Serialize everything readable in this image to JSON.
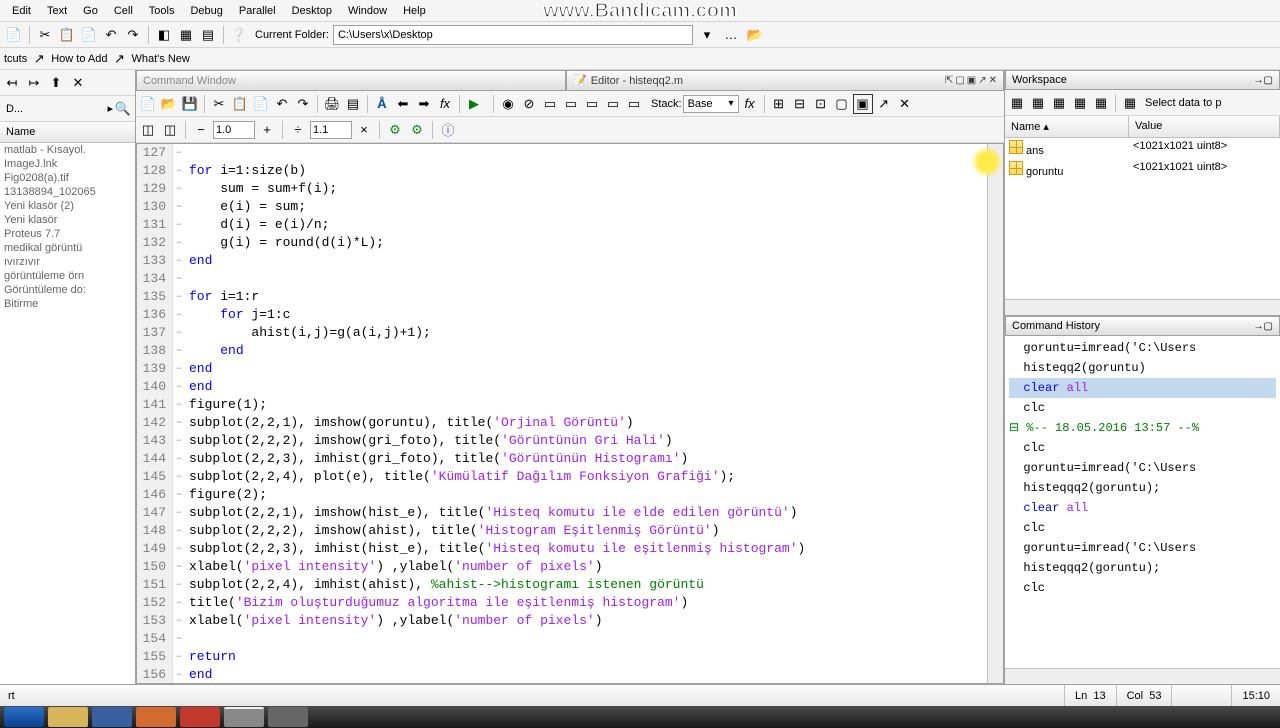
{
  "watermark": "www.Bandicam.com",
  "menus": [
    "Edit",
    "Text",
    "Go",
    "Cell",
    "Tools",
    "Debug",
    "Parallel",
    "Desktop",
    "Window",
    "Help"
  ],
  "toolbar1": {
    "current_folder_label": "Current Folder:",
    "current_folder_value": "C:\\Users\\x\\Desktop"
  },
  "shortcuts": {
    "cuts": "tcuts",
    "how_to_add": "How to Add",
    "whats_new": "What's New"
  },
  "left": {
    "addr_fragment": "D...",
    "name_col": "Name",
    "files": [
      "matlab - Kısayol.",
      "ImageJ.lnk",
      "Fig0208(a).tif",
      "13138894_102065",
      "Yeni klasör (2)",
      "Yeni klasör",
      "Proteus 7.7",
      "medikal görüntü",
      "ıvırzıvır",
      "görüntüleme örn",
      "Görüntüleme do:",
      "Bitirme"
    ]
  },
  "center": {
    "cmd_title": "Command Window",
    "editor_title": "Editor - histeqq2.m",
    "stack_label": "Stack:",
    "stack_value": "Base",
    "zoom1": "1.0",
    "zoom2": "1.1",
    "lines": [
      {
        "n": 127,
        "html": ""
      },
      {
        "n": 128,
        "html": "<span class='kw'>for</span> i=1:size(b)"
      },
      {
        "n": 129,
        "html": "    sum = sum+f(i);"
      },
      {
        "n": 130,
        "html": "    e(i) = sum;"
      },
      {
        "n": 131,
        "html": "    d(i) = e(i)/n;"
      },
      {
        "n": 132,
        "html": "    g(i) = round(d(i)*L);"
      },
      {
        "n": 133,
        "html": "<span class='kw'>end</span>"
      },
      {
        "n": 134,
        "html": ""
      },
      {
        "n": 135,
        "html": "<span class='kw'>for</span> i=1:r"
      },
      {
        "n": 136,
        "html": "    <span class='kw'>for</span> j=1:c"
      },
      {
        "n": 137,
        "html": "        ahist(i,j)=g(a(i,j)+1);"
      },
      {
        "n": 138,
        "html": "    <span class='kw'>end</span>"
      },
      {
        "n": 139,
        "html": "<span class='kw'>end</span>"
      },
      {
        "n": 140,
        "html": "<span class='kw'>end</span>"
      },
      {
        "n": 141,
        "html": "figure(1);"
      },
      {
        "n": 142,
        "html": "subplot(2,2,1), imshow(goruntu), title(<span class='str'>'Orjinal Görüntü'</span>)"
      },
      {
        "n": 143,
        "html": "subplot(2,2,2), imshow(gri_foto), title(<span class='str'>'Görüntünün Gri Hali'</span>)"
      },
      {
        "n": 144,
        "html": "subplot(2,2,3), imhist(gri_foto), title(<span class='str'>'Görüntünün Histogramı'</span>)"
      },
      {
        "n": 145,
        "html": "subplot(2,2,4), plot(e), title(<span class='str'>'Kümülatif Dağılım Fonksiyon Grafiği'</span>);"
      },
      {
        "n": 146,
        "html": "figure(2);"
      },
      {
        "n": 147,
        "html": "subplot(2,2,1), imshow(hist_e), title(<span class='str'>'Histeq komutu ile elde edilen görüntü'</span>)"
      },
      {
        "n": 148,
        "html": "subplot(2,2,2), imshow(ahist), title(<span class='str'>'Histogram Eşitlenmiş Görüntü'</span>)"
      },
      {
        "n": 149,
        "html": "subplot(2,2,3), imhist(hist_e), title(<span class='str'>'Histeq komutu ile eşitlenmiş histogram'</span>)"
      },
      {
        "n": 150,
        "html": "xlabel(<span class='str'>'pixel intensity'</span>) ,ylabel(<span class='str'>'number of pixels'</span>)"
      },
      {
        "n": 151,
        "html": "subplot(2,2,4), imhist(ahist), <span class='com'>%ahist--&gt;histogramı istenen görüntü</span>"
      },
      {
        "n": 152,
        "html": "title(<span class='str'>'Bizim oluşturduğumuz algoritma ile eşitlenmiş histogram'</span>)"
      },
      {
        "n": 153,
        "html": "xlabel(<span class='str'>'pixel intensity'</span>) ,ylabel(<span class='str'>'number of pixels'</span>)"
      },
      {
        "n": 154,
        "html": ""
      },
      {
        "n": 155,
        "html": "<span class='kw'>return</span>"
      },
      {
        "n": 156,
        "html": "<span class='kw'>end</span>"
      }
    ]
  },
  "workspace": {
    "title": "Workspace",
    "select_label": "Select data to p",
    "name_col": "Name",
    "value_col": "Value",
    "rows": [
      {
        "name": "ans",
        "value": "<1021x1021 uint8>"
      },
      {
        "name": "goruntu",
        "value": "<1021x1021 uint8>"
      }
    ]
  },
  "history": {
    "title": "Command History",
    "items": [
      {
        "t": "  goruntu=imread('C:\\Users",
        "cls": ""
      },
      {
        "t": "  histeqq2(goruntu)",
        "cls": ""
      },
      {
        "t": "  clear all",
        "cls": "ch-sel"
      },
      {
        "t": "  clc",
        "cls": ""
      },
      {
        "t": "%-- 18.05.2016 13:57 --%",
        "cls": "ch-grey"
      },
      {
        "t": "  clc",
        "cls": ""
      },
      {
        "t": "  goruntu=imread('C:\\Users",
        "cls": ""
      },
      {
        "t": "  histeqqq2(goruntu);",
        "cls": ""
      },
      {
        "t": "  clear all",
        "cls": ""
      },
      {
        "t": "  clc",
        "cls": ""
      },
      {
        "t": "  goruntu=imread('C:\\Users",
        "cls": ""
      },
      {
        "t": "  histeqqq2(goruntu);",
        "cls": ""
      },
      {
        "t": "  clc",
        "cls": ""
      }
    ]
  },
  "status": {
    "rt": "rt",
    "ln_label": "Ln",
    "ln": "13",
    "col_label": "Col",
    "col": "53",
    "time": "15:10"
  }
}
